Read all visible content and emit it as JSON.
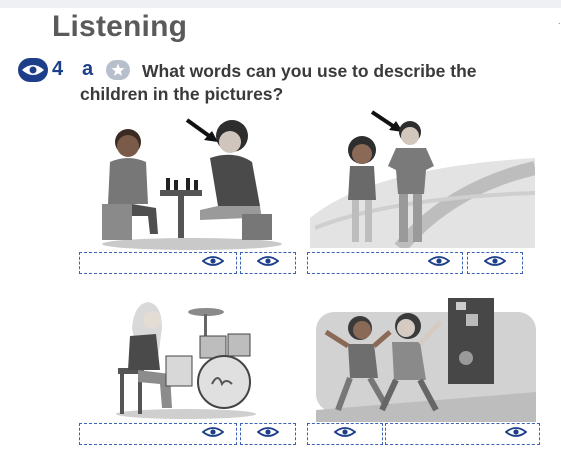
{
  "heading": "Listening",
  "question": {
    "number": "4",
    "letter": "a",
    "text_line1": "What words can you use to describe the",
    "text_line2": "children in the pictures?"
  },
  "colors": {
    "accent": "#1d3f8a",
    "heading": "#5a5a5a",
    "dashed_box": "#3d63b6"
  },
  "icons": [
    "eye-icon",
    "star-icon",
    "arrow-icon"
  ]
}
